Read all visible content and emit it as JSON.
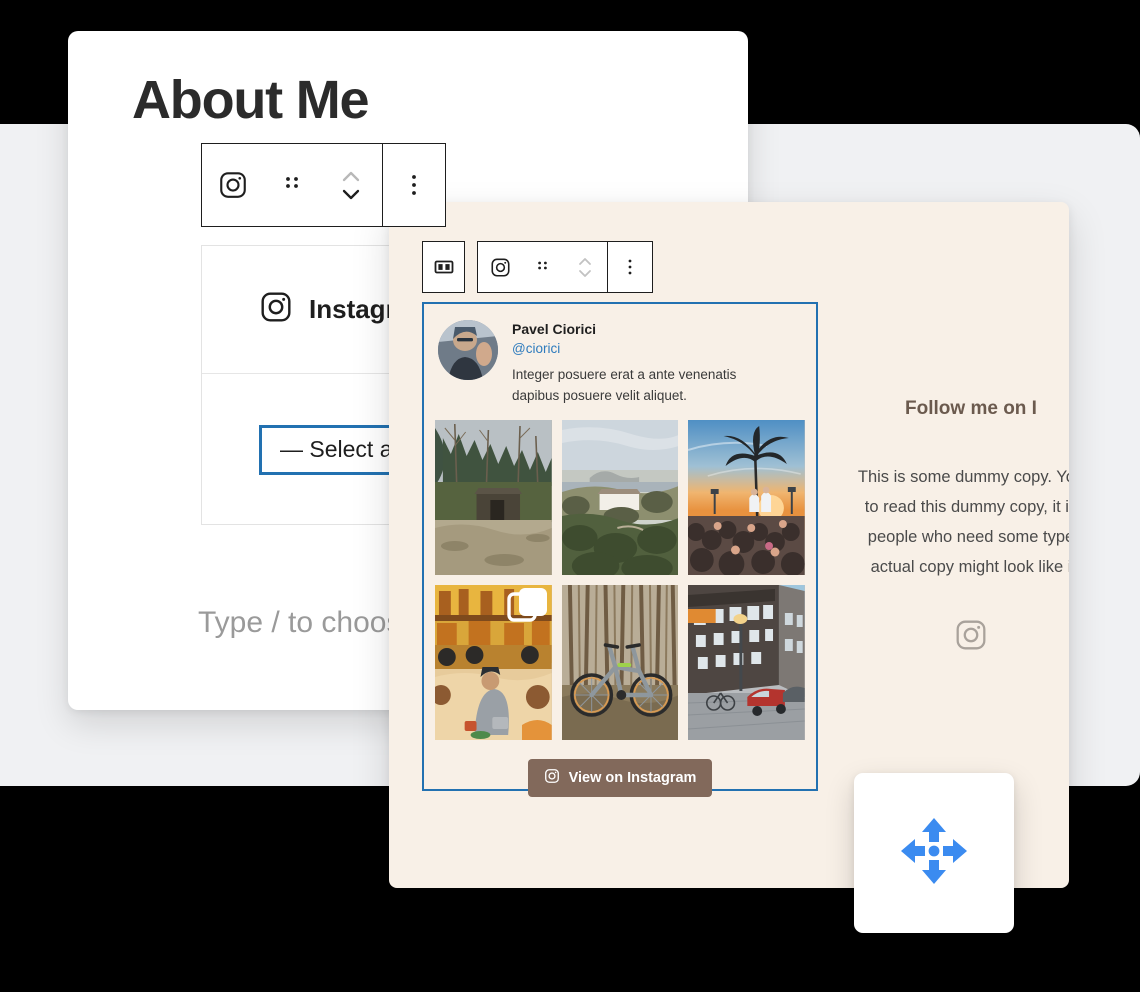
{
  "editor": {
    "page_heading": "About Me",
    "block_toolbar": {
      "buttons": [
        {
          "name": "instagram-block-icon",
          "label": "Instagram Feed block"
        },
        {
          "name": "drag-handle-icon",
          "label": "Drag"
        },
        {
          "name": "move-up-down-icon",
          "label": "Move up or down"
        },
        {
          "name": "more-options-icon",
          "label": "Options"
        }
      ]
    },
    "feed_block": {
      "icon": "instagram-icon",
      "title": "Instagram Fe",
      "select_value": "— Select a Feed t",
      "select_border_color": "#2271b1"
    },
    "placeholder_paragraph": "Type / to choose a b"
  },
  "preview": {
    "toolbars": {
      "left_button": {
        "name": "split-layout-icon",
        "label": "Change layout"
      },
      "block_buttons": [
        {
          "name": "instagram-block-icon",
          "label": "Instagram Feed block"
        },
        {
          "name": "drag-handle-icon",
          "label": "Drag"
        },
        {
          "name": "move-up-down-icon",
          "label": "Move up or down"
        },
        {
          "name": "more-options-icon",
          "label": "Options"
        }
      ]
    },
    "feed_embed": {
      "selection_color": "#2271b1",
      "profile": {
        "display_name": "Pavel Ciorici",
        "handle": "@ciorici",
        "caption": "Integer posuere erat a ante venenatis dapibus posuere velit aliquet."
      },
      "photos": [
        {
          "name": "photo-forest-cabin",
          "alt": "Cabin in a forest clearing"
        },
        {
          "name": "photo-coastal-villa",
          "alt": "White villa on a coastal hillside"
        },
        {
          "name": "photo-palm-sunset-crowd",
          "alt": "Crowd by a palm tree at sunset"
        },
        {
          "name": "photo-beach-gathering",
          "alt": "People sitting on sand by a yellow building"
        },
        {
          "name": "photo-mountain-bike",
          "alt": "Mountain bike in a pine forest"
        },
        {
          "name": "photo-city-street",
          "alt": "Row of buildings with parked cars"
        }
      ],
      "cta_button": {
        "label": "View on Instagram",
        "icon": "instagram-icon",
        "background": "#82695b",
        "text_color": "#ffffff"
      }
    },
    "follow_column": {
      "heading": "Follow me on I",
      "body_lines": [
        "This is some dummy copy. You",
        "to read this dummy copy, it is",
        "people who need some type",
        "actual copy might look like i"
      ],
      "icon": "instagram-icon"
    }
  },
  "drag_card": {
    "icon": "move-arrows-icon",
    "icon_color": "#3b8bf0"
  },
  "theme": {
    "page_background": "#000000",
    "back_panel": "#f0f1f3",
    "editor_card": "#ffffff",
    "preview_card": "#f8f0e7",
    "accent_blue": "#2271b1",
    "brand_brown": "#82695b"
  }
}
